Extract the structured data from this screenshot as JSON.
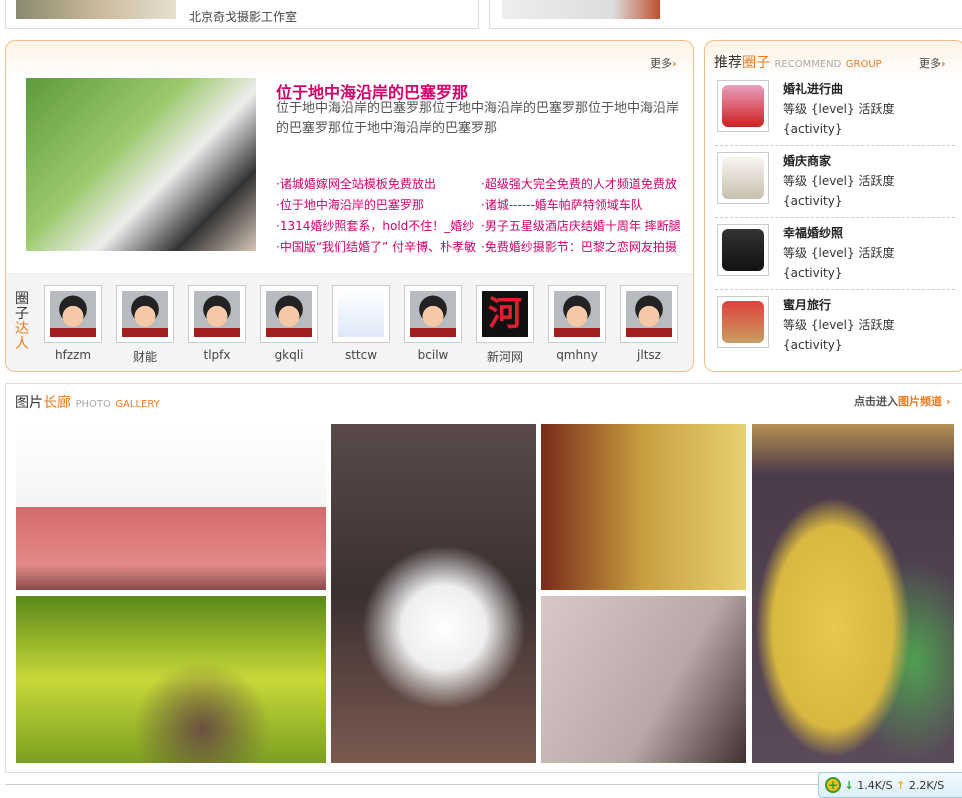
{
  "top": {
    "studio_link": "北京奇戈摄影工作室"
  },
  "feature": {
    "more": "更多",
    "title": "位于地中海沿岸的巴塞罗那",
    "description": "位于地中海沿岸的巴塞罗那位于地中海沿岸的巴塞罗那位于地中海沿岸的巴塞罗那位于地中海沿岸的巴塞罗那",
    "links": [
      "诸城婚嫁网全站模板免费放出",
      "超级强大完全免费的人才频道免费放",
      "位于地中海沿岸的巴塞罗那",
      "诸城------婚车帕萨特领域车队",
      "1314婚纱照套系，hold不住！_婚纱",
      "男子五星级酒店庆结婚十周年 摔断腿",
      "中国版“我们结婚了” 付辛博、朴孝敏",
      "免费婚纱摄影节：巴黎之恋网友拍摄"
    ],
    "experts_label_1": "圈子",
    "experts_label_2": "达人",
    "experts": [
      "hfzzm",
      "财能",
      "tlpfx",
      "gkqli",
      "sttcw",
      "bcilw",
      "新河网",
      "qmhny",
      "jltsz"
    ]
  },
  "groups": {
    "title_1": "推荐",
    "title_2": "圈子",
    "subtitle_1": "RECOMMEND",
    "subtitle_2": "GROUP",
    "more": "更多",
    "items": [
      {
        "name": "婚礼进行曲",
        "level_label": "等级",
        "level": "{level}",
        "activity_label": "活跃度",
        "activity": "{activity}"
      },
      {
        "name": "婚庆商家",
        "level_label": "等级",
        "level": "{level}",
        "activity_label": "活跃度",
        "activity": "{activity}"
      },
      {
        "name": "幸福婚纱照",
        "level_label": "等级",
        "level": "{level}",
        "activity_label": "活跃度",
        "activity": "{activity}"
      },
      {
        "name": "蜜月旅行",
        "level_label": "等级",
        "level": "{level}",
        "activity_label": "活跃度",
        "activity": "{activity}"
      }
    ]
  },
  "gallery": {
    "title_1": "图片",
    "title_2": "长廊",
    "subtitle_1": "PHOTO",
    "subtitle_2": "GALLERY",
    "enter_1": "点击进入",
    "enter_2": "图片频道"
  },
  "netspeed": {
    "down": "1.4K/S",
    "up": "2.2K/S"
  }
}
